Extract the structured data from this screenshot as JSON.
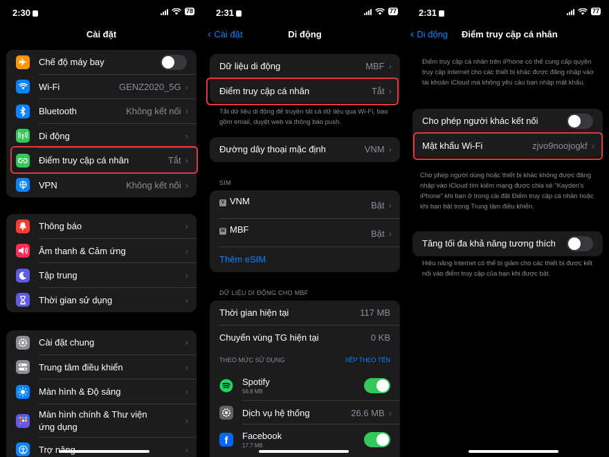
{
  "p1": {
    "time": "2:30",
    "battery": "78",
    "title": "Cài đặt",
    "groups": [
      [
        {
          "label": "Chế độ máy bay",
          "toggle": false,
          "icon": "airplane-icon",
          "color": "#ff9500"
        },
        {
          "label": "Wi-Fi",
          "value": "GENZ2020_5G",
          "icon": "wifi-icon",
          "color": "#0a84ff"
        },
        {
          "label": "Bluetooth",
          "value": "Không kết nối",
          "icon": "bluetooth-icon",
          "color": "#0a84ff"
        },
        {
          "label": "Di động",
          "value": "",
          "icon": "cellular-icon",
          "color": "#34c759"
        },
        {
          "label": "Điểm truy cập cá nhân",
          "value": "Tắt",
          "icon": "hotspot-icon",
          "color": "#34c759"
        },
        {
          "label": "VPN",
          "value": "Không kết nối",
          "icon": "vpn-icon",
          "color": "#0a84ff"
        }
      ],
      [
        {
          "label": "Thông báo",
          "icon": "bell-icon",
          "color": "#ff3b30"
        },
        {
          "label": "Âm thanh & Cảm ứng",
          "icon": "speaker-icon",
          "color": "#ff2d55"
        },
        {
          "label": "Tập trung",
          "icon": "moon-icon",
          "color": "#5e5ce6"
        },
        {
          "label": "Thời gian sử dụng",
          "icon": "hourglass-icon",
          "color": "#5e5ce6"
        }
      ],
      [
        {
          "label": "Cài đặt chung",
          "icon": "gear-icon",
          "color": "#8e8e93"
        },
        {
          "label": "Trung tâm điều khiển",
          "icon": "toggles-icon",
          "color": "#8e8e93"
        },
        {
          "label": "Màn hình & Độ sáng",
          "icon": "sun-icon",
          "color": "#0a84ff"
        },
        {
          "label": "Màn hình chính & Thư viện ứng dụng",
          "icon": "grid-icon",
          "color": "#5e5ce6"
        },
        {
          "label": "Trợ năng",
          "icon": "accessibility-icon",
          "color": "#0a84ff"
        }
      ]
    ]
  },
  "p2": {
    "time": "2:31",
    "battery": "77",
    "back": "Cài đặt",
    "title": "Di động",
    "row_data": {
      "label": "Dữ liệu di động",
      "value": "MBF"
    },
    "row_hotspot": {
      "label": "Điểm truy cập cá nhân",
      "value": "Tắt"
    },
    "footer1": "Tắt dữ liệu di động để truyền tất cả dữ liệu qua Wi-Fi, bao gồm email, duyệt web và thông báo push.",
    "row_voice": {
      "label": "Đường dây thoại mặc định",
      "value": "VNM"
    },
    "sim_header": "SIM",
    "sim1": {
      "badge": "V",
      "label": "VNM",
      "value": "Bật"
    },
    "sim2": {
      "badge": "M",
      "label": "MBF",
      "value": "Bật"
    },
    "add_esim": "Thêm eSIM",
    "data_header": "DỮ LIỆU DI ĐỘNG CHO MBF",
    "current": {
      "label": "Thời gian hiện tại",
      "value": "117 MB"
    },
    "roaming": {
      "label": "Chuyển vùng TG hiện tại",
      "value": "0 KB"
    },
    "usage_header": "THEO MỨC SỬ DỤNG",
    "sort_by_name": "XẾP THEO TÊN",
    "apps": [
      {
        "label": "Spotify",
        "sub": "56.8 MB",
        "toggle": true
      },
      {
        "label": "Dịch vụ hệ thống",
        "value": "26.6 MB"
      },
      {
        "label": "Facebook",
        "sub": "17.7 MB",
        "toggle": true
      }
    ]
  },
  "p3": {
    "time": "2:31",
    "battery": "77",
    "back": "Di động",
    "title": "Điểm truy cập cá nhân",
    "intro": "Điểm truy cập cá nhân trên iPhone có thể cung cấp quyền truy cập internet cho các thiết bị khác được đăng nhập vào tài khoản iCloud mà không yêu cầu bạn nhập mật khẩu.",
    "allow": {
      "label": "Cho phép người khác kết nối",
      "toggle": false
    },
    "password": {
      "label": "Mật khẩu Wi-Fi",
      "value": "zjvo9noojogkf"
    },
    "footer2": "Cho phép người dùng hoặc thiết bị khác không được đăng nhập vào iCloud tìm kiếm mạng được chia sẻ \"Kayden's iPhone\" khi bạn ở trong cài đặt Điểm truy cập cá nhân hoặc khi bạn bật trong Trung tâm điều khiển.",
    "compat": {
      "label": "Tăng tối đa khả năng tương thích",
      "toggle": false
    },
    "footer3": "Hiệu năng internet có thể bị giảm cho các thiết bị được kết nối vào điểm truy cập của bạn khi được bật."
  }
}
